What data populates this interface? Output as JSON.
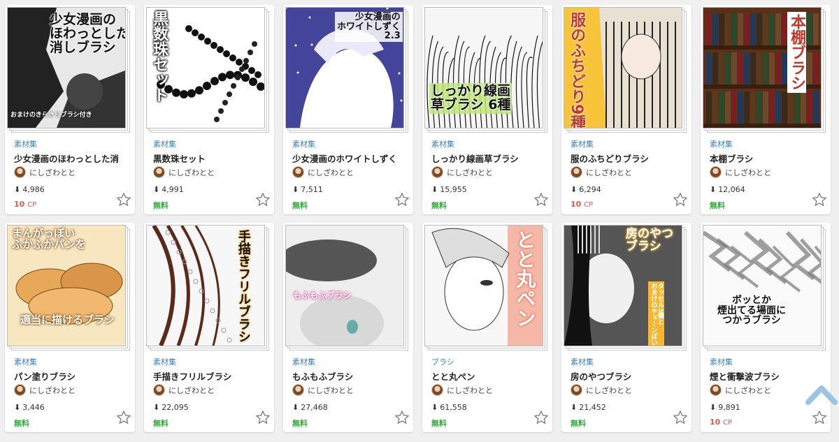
{
  "colors": {
    "category": "#3b82c4",
    "free": "#2eae37",
    "paid": "#e25a4a",
    "scroll_top": "#9cc3e0"
  },
  "icons": {
    "download": "download-icon",
    "favorite": "star-outline-icon",
    "scroll_top": "chevron-up-icon"
  },
  "cards": [
    {
      "category": "素材集",
      "title": "少女漫画のほわっとした消",
      "author": "にしざわとと",
      "downloads": "4,986",
      "price": "10",
      "price_unit": "CP",
      "free": false,
      "thumb": {
        "text": "少女漫画の\nほわっとした\n消しブラシ",
        "sub": "おまけのきらきらブラシ付き"
      }
    },
    {
      "category": "素材集",
      "title": "黒数珠セット",
      "author": "にしざわとと",
      "downloads": "4,991",
      "price": "無料",
      "price_unit": "",
      "free": true,
      "thumb": {
        "text": "黒数珠セット"
      }
    },
    {
      "category": "素材集",
      "title": "少女漫画のホワイトしずく",
      "author": "にしざわとと",
      "downloads": "7,511",
      "price": "無料",
      "price_unit": "",
      "free": true,
      "thumb": {
        "text": "少女漫画の\nホワイトしずく\n2.3"
      }
    },
    {
      "category": "素材集",
      "title": "しっかり線画草ブラシ",
      "author": "にしざわとと",
      "downloads": "15,955",
      "price": "無料",
      "price_unit": "",
      "free": true,
      "thumb": {
        "text": "しっかり線画\n草ブラシ 6種"
      }
    },
    {
      "category": "素材集",
      "title": "服のふちどりブラシ",
      "author": "にしざわとと",
      "downloads": "6,294",
      "price": "10",
      "price_unit": "CP",
      "free": false,
      "thumb": {
        "text": "服のふちどり9種"
      }
    },
    {
      "category": "素材集",
      "title": "本棚ブラシ",
      "author": "にしざわとと",
      "downloads": "12,064",
      "price": "無料",
      "price_unit": "",
      "free": true,
      "thumb": {
        "text": "本棚ブラシ"
      }
    },
    {
      "category": "素材集",
      "title": "パン塗りブラシ",
      "author": "にしざわとと",
      "downloads": "3,446",
      "price": "無料",
      "price_unit": "",
      "free": true,
      "thumb": {
        "text": "まんがっぽい\nふかふかパンを",
        "sub": "適当に描けるブラシ"
      }
    },
    {
      "category": "素材集",
      "title": "手描きフリルブラシ",
      "author": "にしざわとと",
      "downloads": "22,095",
      "price": "無料",
      "price_unit": "",
      "free": true,
      "thumb": {
        "text": "手描きフリルブラシ"
      }
    },
    {
      "category": "素材集",
      "title": "もふもふブラシ",
      "author": "にしざわとと",
      "downloads": "27,468",
      "price": "無料",
      "price_unit": "",
      "free": true,
      "thumb": {
        "text": "もふもふブラシ"
      }
    },
    {
      "category": "ブラシ",
      "title": "とと丸ペン",
      "author": "にしざわとと",
      "downloads": "61,558",
      "price": "無料",
      "price_unit": "",
      "free": true,
      "thumb": {
        "text": "とと丸ペン"
      }
    },
    {
      "category": "素材集",
      "title": "房のやつブラシ",
      "author": "にしざわとと",
      "downloads": "21,452",
      "price": "無料",
      "price_unit": "",
      "free": true,
      "thumb": {
        "text": "房のやつ\nブラシ",
        "sub": "タッセル3種と\nおまけのチェーンぽいの"
      }
    },
    {
      "category": "素材集",
      "title": "煙と衝撃波ブラシ",
      "author": "にしざわとと",
      "downloads": "9,891",
      "price": "10",
      "price_unit": "CP",
      "free": false,
      "thumb": {
        "text": "ボッとか\n煙出てる場面に\nつかうブラシ"
      }
    }
  ]
}
